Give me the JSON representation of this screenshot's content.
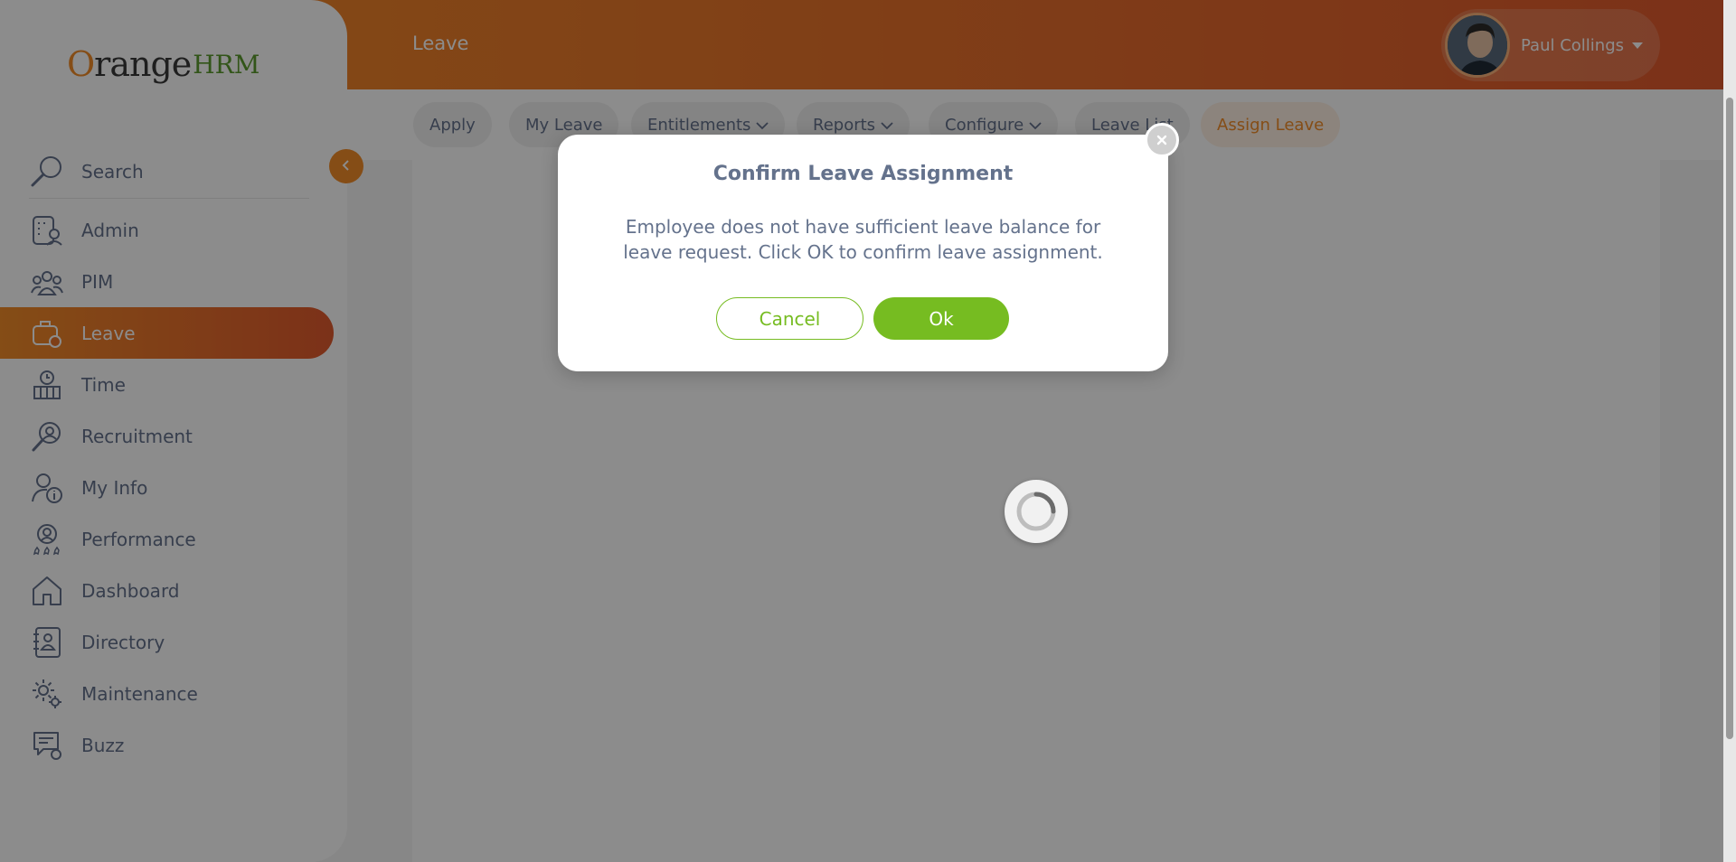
{
  "brand": {
    "name_prefix": "range",
    "name_suffix": "HRM",
    "initial": "O"
  },
  "header": {
    "title": "Leave",
    "user_name": "Paul Collings"
  },
  "sidebar": {
    "search_label": "Search",
    "items": [
      {
        "label": "Admin",
        "icon": "admin-icon"
      },
      {
        "label": "PIM",
        "icon": "pim-icon"
      },
      {
        "label": "Leave",
        "icon": "leave-icon",
        "active": true
      },
      {
        "label": "Time",
        "icon": "time-icon"
      },
      {
        "label": "Recruitment",
        "icon": "recruitment-icon"
      },
      {
        "label": "My Info",
        "icon": "my-info-icon"
      },
      {
        "label": "Performance",
        "icon": "performance-icon"
      },
      {
        "label": "Dashboard",
        "icon": "dashboard-icon"
      },
      {
        "label": "Directory",
        "icon": "directory-icon"
      },
      {
        "label": "Maintenance",
        "icon": "maintenance-icon"
      },
      {
        "label": "Buzz",
        "icon": "buzz-icon"
      }
    ]
  },
  "subnav": {
    "tabs": [
      {
        "label": "Apply"
      },
      {
        "label": "My Leave"
      },
      {
        "label": "Entitlements"
      },
      {
        "label": "Reports"
      },
      {
        "label": "Configure"
      },
      {
        "label": "Leave List"
      },
      {
        "label": "Assign Leave",
        "active": true
      }
    ]
  },
  "dialog": {
    "title": "Confirm Leave Assignment",
    "message": "Employee does not have sufficient leave balance for leave request. Click OK to confirm leave assignment.",
    "cancel_label": "Cancel",
    "ok_label": "Ok"
  },
  "colors": {
    "accent": "#f28c28",
    "accent_dark": "#e15a2e",
    "green": "#76bc21",
    "text": "#64728c"
  }
}
